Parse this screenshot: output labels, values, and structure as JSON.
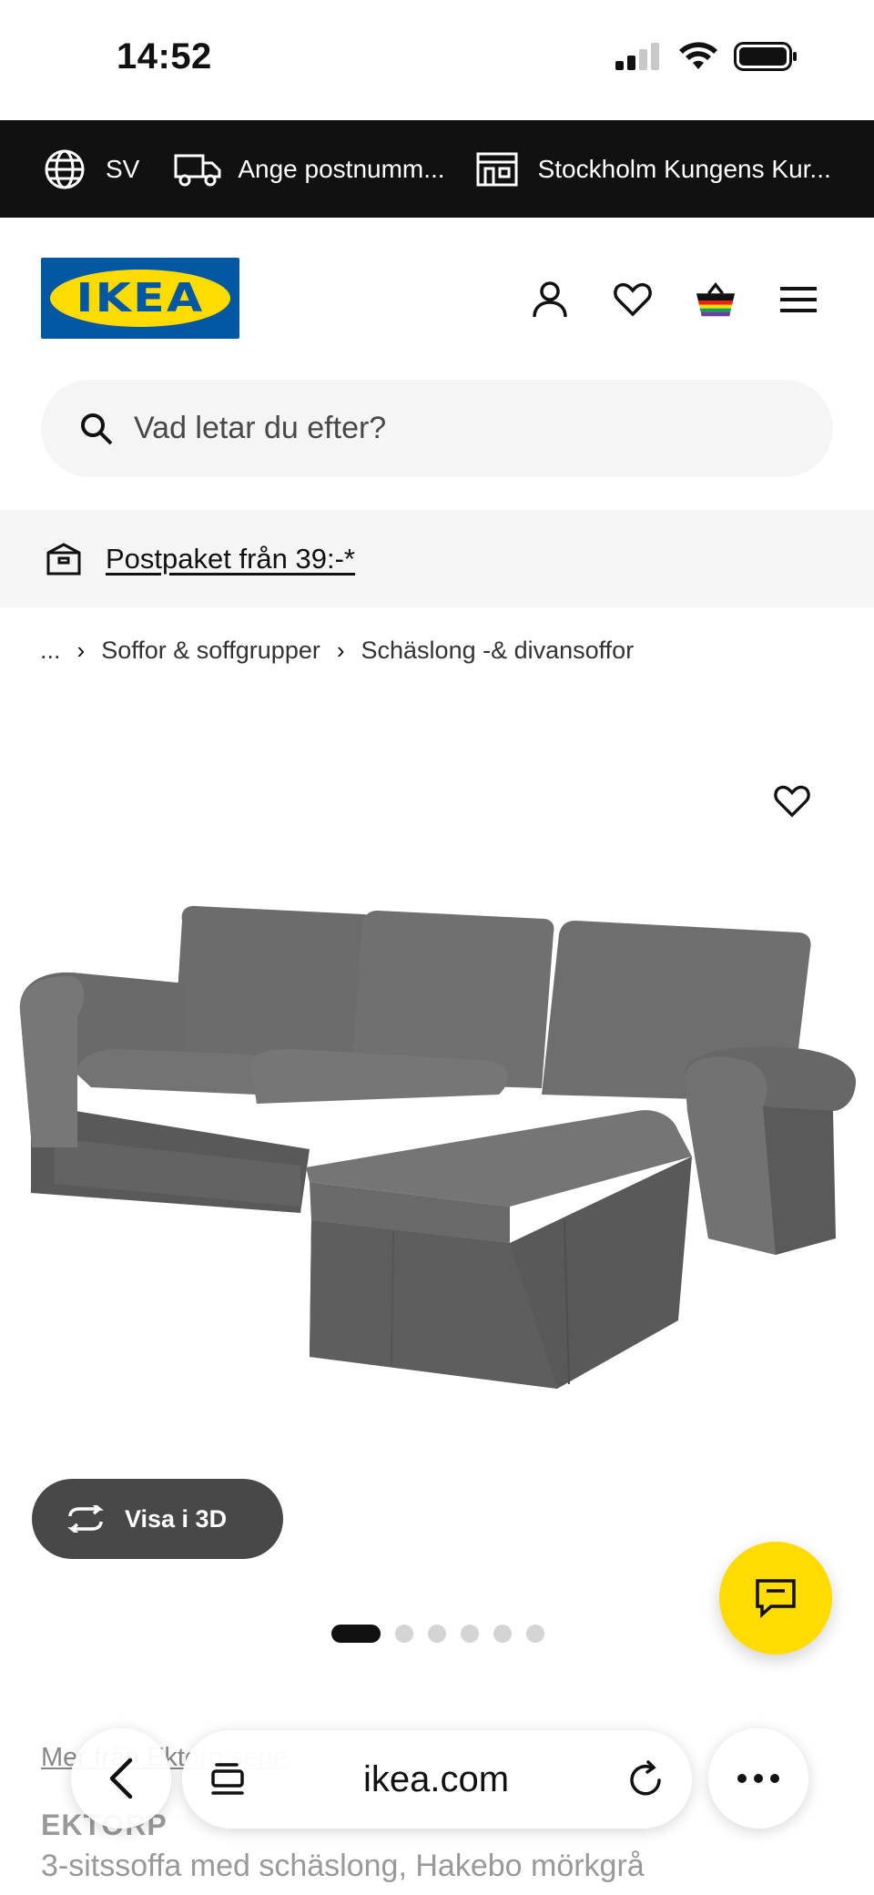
{
  "status_bar": {
    "time": "14:52"
  },
  "utility_bar": {
    "language": "SV",
    "postcode": "Ange postnumm...",
    "store": "Stockholm Kungens Kur..."
  },
  "header": {
    "logo_text": "IKEA",
    "icons": [
      "user-icon",
      "heart-icon",
      "cart-icon",
      "menu-icon"
    ]
  },
  "search": {
    "placeholder": "Vad letar du efter?"
  },
  "promo": {
    "text": "Postpaket från 39:-*"
  },
  "breadcrumb": {
    "ellipsis": "...",
    "items": [
      "Soffor & soffgrupper",
      "Schäslong -& divansoffor"
    ]
  },
  "product": {
    "view_3d_label": "Visa i 3D",
    "image_count": 6,
    "active_image": 1,
    "more_link": "Mer från Ektorp serie",
    "name": "EKTORP",
    "description": "3-sitssoffa med schäslong, Hakebo mörkgrå"
  },
  "browser": {
    "url": "ikea.com"
  },
  "colors": {
    "brand_blue": "#0058a3",
    "brand_yellow": "#ffdb00",
    "dark_bar": "#111111"
  }
}
